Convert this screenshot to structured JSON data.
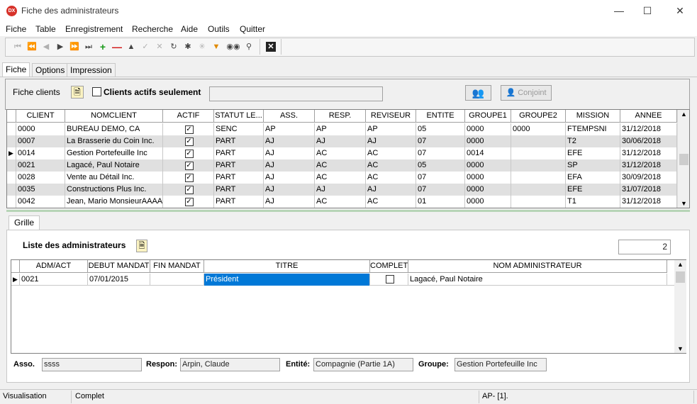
{
  "window": {
    "title": "Fiche des administrateurs",
    "logo": "DX"
  },
  "menu": [
    "Fiche",
    "Table",
    "Enregistrement",
    "Recherche",
    "Aide",
    "Outils",
    "Quitter"
  ],
  "tabs": {
    "main": [
      "Fiche",
      "Options",
      "Impression"
    ],
    "sub": "Grille"
  },
  "top_panel": {
    "label": "Fiche clients",
    "checkbox_label": "Clients actifs seulement",
    "search_value": "",
    "conjoint_label": "Conjoint"
  },
  "clients_grid": {
    "headers": [
      "CLIENT",
      "NOMCLIENT",
      "ACTIF",
      "STATUT LE...",
      "ASS.",
      "RESP.",
      "REVISEUR",
      "ENTITE",
      "GROUPE1",
      "GROUPE2",
      "MISSION",
      "ANNEE"
    ],
    "rows": [
      [
        "0000",
        "BUREAU DEMO, CA",
        "✓",
        "SENC",
        "AP",
        "AP",
        "AP",
        "05",
        "0000",
        "0000",
        "FTEMPSNI",
        "31/12/2018"
      ],
      [
        "0007",
        "La Brasserie du Coin Inc.",
        "✓",
        "PART",
        "AJ",
        "AJ",
        "AJ",
        "07",
        "0000",
        "",
        "T2",
        "30/06/2018"
      ],
      [
        "0014",
        "Gestion Portefeuille Inc",
        "✓",
        "PART",
        "AJ",
        "AC",
        "AC",
        "07",
        "0014",
        "",
        "EFE",
        "31/12/2018"
      ],
      [
        "0021",
        "Lagacé, Paul Notaire",
        "✓",
        "PART",
        "AJ",
        "AC",
        "AC",
        "05",
        "0000",
        "",
        "SP",
        "31/12/2018"
      ],
      [
        "0028",
        "Vente au Détail Inc.",
        "✓",
        "PART",
        "AJ",
        "AC",
        "AC",
        "07",
        "0000",
        "",
        "EFA",
        "30/09/2018"
      ],
      [
        "0035",
        "Constructions Plus  Inc.",
        "✓",
        "PART",
        "AJ",
        "AJ",
        "AJ",
        "07",
        "0000",
        "",
        "EFE",
        "31/07/2018"
      ],
      [
        "0042",
        "Jean, Mario MonsieurAAAA",
        "✓",
        "PART",
        "AJ",
        "AC",
        "AC",
        "01",
        "0000",
        "",
        "T1",
        "31/12/2018"
      ]
    ]
  },
  "admins": {
    "title": "Liste des administrateurs",
    "count": "2",
    "headers": [
      "ADM/ACT",
      "DEBUT MANDAT",
      "FIN MANDAT",
      "TITRE",
      "COMPLET",
      "NOM ADMINISTRATEUR"
    ],
    "rows": [
      [
        "0021",
        "07/01/2015",
        "",
        "Président",
        "",
        "Lagacé, Paul Notaire"
      ]
    ]
  },
  "footer_fields": {
    "asso_label": "Asso.",
    "asso_value": "ssss",
    "respon_label": "Respon:",
    "respon_value": "Arpin, Claude",
    "entite_label": "Entité:",
    "entite_value": "Compagnie (Partie 1A)",
    "groupe_label": "Groupe:",
    "groupe_value": "Gestion Portefeuille Inc"
  },
  "status": {
    "mode": "Visualisation",
    "state": "Complet",
    "info": "AP- [1]."
  },
  "colors": {
    "selection": "#0078d7",
    "accent_red": "#d7322a"
  }
}
